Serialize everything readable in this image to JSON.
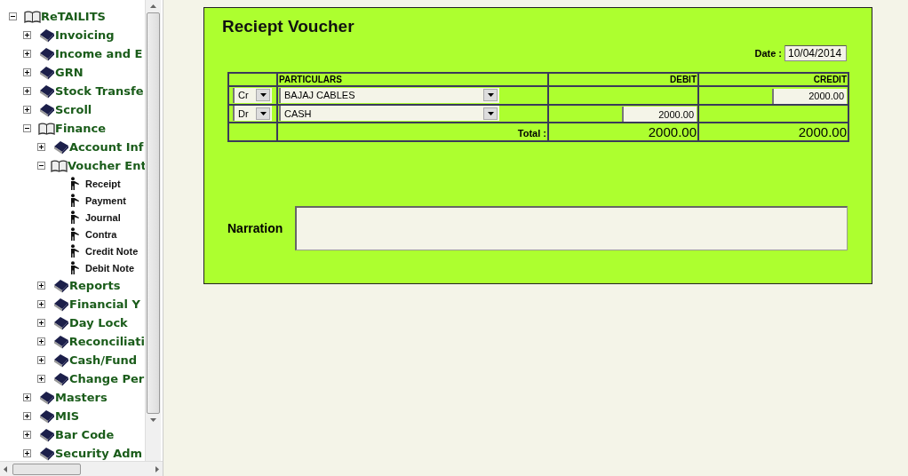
{
  "tree": {
    "label": "ReTAILITS",
    "kind": "folder",
    "expanded": true,
    "children": [
      {
        "label": "Invoicing",
        "kind": "folder",
        "expanded": false
      },
      {
        "label": "Income and E",
        "kind": "folder",
        "expanded": false
      },
      {
        "label": "GRN",
        "kind": "folder",
        "expanded": false
      },
      {
        "label": "Stock Transfe",
        "kind": "folder",
        "expanded": false
      },
      {
        "label": "Scroll",
        "kind": "folder",
        "expanded": false
      },
      {
        "label": "Finance",
        "kind": "folder",
        "expanded": true,
        "children": [
          {
            "label": "Account Inf",
            "kind": "folder",
            "expanded": false
          },
          {
            "label": "Voucher Ent",
            "kind": "folder",
            "expanded": true,
            "children": [
              {
                "label": "Receipt",
                "kind": "leaf"
              },
              {
                "label": "Payment",
                "kind": "leaf"
              },
              {
                "label": "Journal",
                "kind": "leaf"
              },
              {
                "label": "Contra",
                "kind": "leaf"
              },
              {
                "label": "Credit Note",
                "kind": "leaf"
              },
              {
                "label": "Debit Note",
                "kind": "leaf"
              }
            ]
          },
          {
            "label": "Reports",
            "kind": "folder",
            "expanded": false
          },
          {
            "label": "Financial Y",
            "kind": "folder",
            "expanded": false
          },
          {
            "label": "Day Lock",
            "kind": "folder",
            "expanded": false
          },
          {
            "label": "Reconciliati",
            "kind": "folder",
            "expanded": false
          },
          {
            "label": "Cash/Fund",
            "kind": "folder",
            "expanded": false
          },
          {
            "label": "Change Per",
            "kind": "folder",
            "expanded": false
          }
        ]
      },
      {
        "label": "Masters",
        "kind": "folder",
        "expanded": false
      },
      {
        "label": "MIS",
        "kind": "folder",
        "expanded": false
      },
      {
        "label": "Bar Code",
        "kind": "folder",
        "expanded": false
      },
      {
        "label": "Security Adm",
        "kind": "folder",
        "expanded": false
      }
    ]
  },
  "voucher": {
    "title": "Reciept Voucher",
    "date_label": "Date :",
    "date": "10/04/2014",
    "columns": [
      "PARTICULARS",
      "DEBIT",
      "CREDIT"
    ],
    "rows": [
      {
        "type": "Cr",
        "account": "BAJAJ CABLES",
        "debit": "",
        "credit": "2000.00"
      },
      {
        "type": "Dr",
        "account": "CASH",
        "debit": "2000.00",
        "credit": ""
      }
    ],
    "total_label": "Total :",
    "total_debit": "2000.00",
    "total_credit": "2000.00",
    "narration_label": "Narration"
  }
}
